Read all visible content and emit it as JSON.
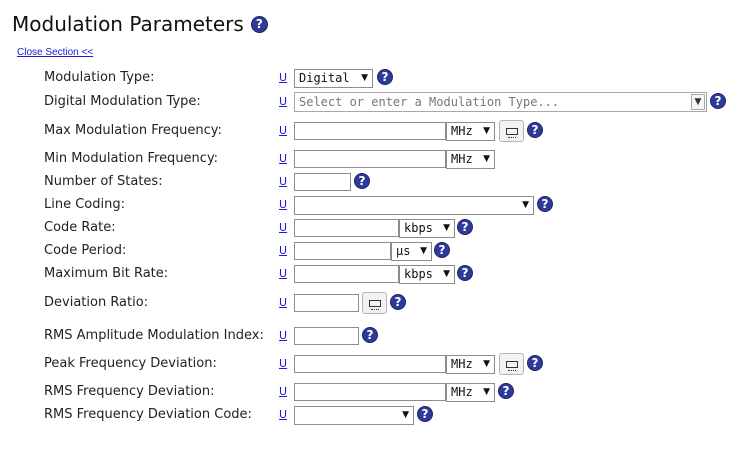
{
  "section": {
    "title": "Modulation Parameters",
    "close_link": "Close Section <<"
  },
  "units_link": "U",
  "fields": {
    "modulation_type": {
      "label": "Modulation Type:",
      "value": "Digital"
    },
    "digital_modulation_type": {
      "label": "Digital Modulation Type:",
      "placeholder": "Select or enter a Modulation Type..."
    },
    "max_mod_freq": {
      "label": "Max Modulation Frequency:",
      "value": "",
      "unit": "MHz"
    },
    "min_mod_freq": {
      "label": "Min Modulation Frequency:",
      "value": "",
      "unit": "MHz"
    },
    "num_states": {
      "label": "Number of States:",
      "value": ""
    },
    "line_coding": {
      "label": "Line Coding:",
      "value": ""
    },
    "code_rate": {
      "label": "Code Rate:",
      "value": "",
      "unit": "kbps"
    },
    "code_period": {
      "label": "Code Period:",
      "value": "",
      "unit": "µs"
    },
    "max_bit_rate": {
      "label": "Maximum Bit Rate:",
      "value": "",
      "unit": "kbps"
    },
    "deviation_ratio": {
      "label": "Deviation Ratio:",
      "value": ""
    },
    "rms_amp_mod_index": {
      "label": "RMS Amplitude Modulation Index:",
      "value": ""
    },
    "peak_freq_dev": {
      "label": "Peak Frequency Deviation:",
      "value": "",
      "unit": "MHz"
    },
    "rms_freq_dev": {
      "label": "RMS Frequency Deviation:",
      "value": "",
      "unit": "MHz"
    },
    "rms_freq_dev_code": {
      "label": "RMS Frequency Deviation Code:",
      "value": ""
    }
  },
  "help_glyph": "?",
  "arrow_glyph": "▼",
  "colors": {
    "help_bg": "#2e3a97",
    "link": "#1a1ad8"
  }
}
